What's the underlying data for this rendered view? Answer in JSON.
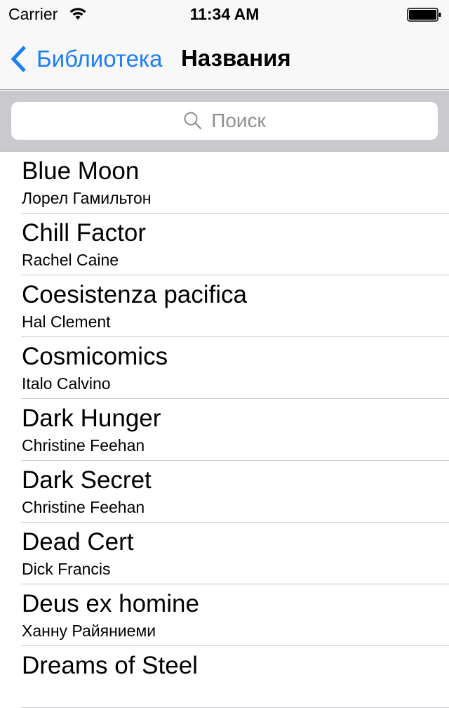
{
  "status_bar": {
    "carrier": "Carrier",
    "time": "11:34 AM",
    "wifi_icon": "wifi-icon",
    "battery_icon": "battery-full-icon"
  },
  "nav": {
    "back_label": "Библиотека",
    "back_icon": "chevron-left-icon",
    "title": "Названия",
    "accent_color": "#1a7ef5"
  },
  "search": {
    "placeholder": "Поиск",
    "icon": "search-icon"
  },
  "books": [
    {
      "title": "Blue Moon",
      "author": "Лорел Гамильтон"
    },
    {
      "title": "Chill Factor",
      "author": "Rachel Caine"
    },
    {
      "title": "Coesistenza pacifica",
      "author": "Hal Clement"
    },
    {
      "title": "Cosmicomics",
      "author": "Italo Calvino"
    },
    {
      "title": "Dark Hunger",
      "author": "Christine Feehan"
    },
    {
      "title": "Dark Secret",
      "author": "Christine Feehan"
    },
    {
      "title": "Dead Cert",
      "author": "Dick Francis"
    },
    {
      "title": "Deus ex homine",
      "author": "Ханну Райяниеми"
    },
    {
      "title": "Dreams of Steel",
      "author": ""
    }
  ]
}
